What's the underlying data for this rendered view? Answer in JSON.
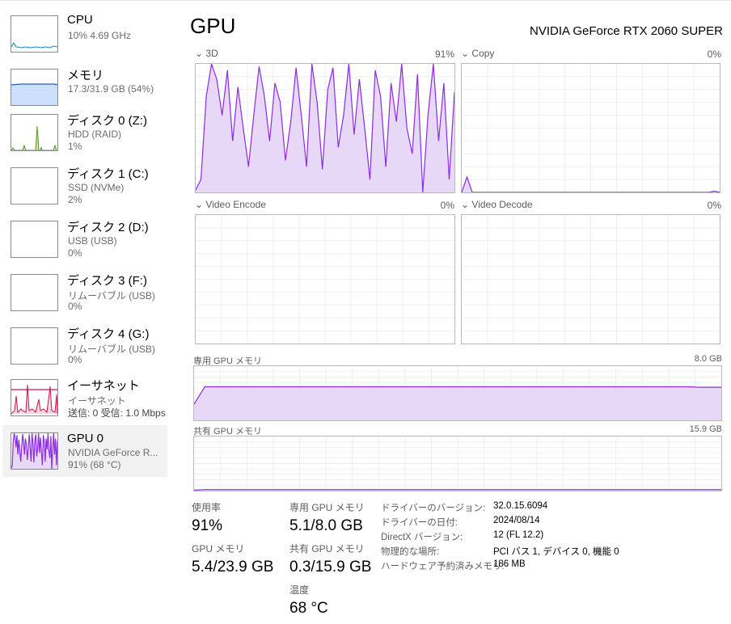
{
  "colors": {
    "gpu": "#8b2be2",
    "gpu_fill": "#e7d8f8",
    "cpu": "#1a8aa8",
    "mem": "#1f5fc9",
    "mem_fill": "#cce0fb",
    "disk": "#5e9c1e",
    "net": "#c5184c",
    "net_fill": "#f7d6df"
  },
  "sidebar": {
    "items": [
      {
        "title": "CPU",
        "line1": "10%  4.69 GHz",
        "line2": ""
      },
      {
        "title": "メモリ",
        "line1": "17.3/31.9 GB (54%)",
        "line2": ""
      },
      {
        "title": "ディスク 0 (Z:)",
        "line1": "HDD (RAID)",
        "line2": "1%"
      },
      {
        "title": "ディスク 1 (C:)",
        "line1": "SSD (NVMe)",
        "line2": "2%"
      },
      {
        "title": "ディスク 2 (D:)",
        "line1": "USB (USB)",
        "line2": "0%"
      },
      {
        "title": "ディスク 3 (F:)",
        "line1": "リムーバブル (USB)",
        "line2": "0%"
      },
      {
        "title": "ディスク 4 (G:)",
        "line1": "リムーバブル (USB)",
        "line2": "0%"
      },
      {
        "title": "イーサネット",
        "line1": "イーサネット",
        "line2": "送信: 0 受信: 1.0 Mbps"
      },
      {
        "title": "GPU 0",
        "line1": "NVIDIA GeForce R...",
        "line2": "91% (68 °C)"
      }
    ]
  },
  "header": {
    "title": "GPU",
    "model": "NVIDIA GeForce RTX 2060 SUPER"
  },
  "engines": [
    {
      "name": "3D",
      "value": "91%"
    },
    {
      "name": "Copy",
      "value": "0%"
    },
    {
      "name": "Video Encode",
      "value": "0%"
    },
    {
      "name": "Video Decode",
      "value": "0%"
    }
  ],
  "memory_graphs": {
    "dedicated": {
      "label": "専用 GPU メモリ",
      "max": "8.0 GB"
    },
    "shared": {
      "label": "共有 GPU メモリ",
      "max": "15.9 GB"
    }
  },
  "series": {
    "3d": [
      2,
      10,
      75,
      100,
      88,
      60,
      95,
      40,
      82,
      50,
      20,
      60,
      98,
      75,
      40,
      85,
      70,
      25,
      55,
      97,
      60,
      20,
      100,
      70,
      18,
      80,
      97,
      35,
      60,
      100,
      45,
      88,
      50,
      10,
      95,
      75,
      20,
      85,
      55,
      100,
      50,
      30,
      92,
      0,
      60,
      100,
      40,
      85,
      10,
      78
    ],
    "copy": [
      0,
      12,
      0,
      0,
      0,
      0,
      0,
      0,
      0,
      0,
      0,
      0,
      0,
      0,
      0,
      0,
      0,
      0,
      0,
      0,
      0,
      0,
      0,
      0,
      0,
      0,
      0,
      0,
      0,
      0,
      0,
      0,
      0,
      0,
      0,
      0,
      0,
      0,
      0,
      0,
      0,
      0,
      0,
      0,
      0,
      0,
      0,
      0,
      1,
      0
    ],
    "dedicated": [
      30,
      62,
      62,
      62,
      62,
      62,
      62,
      62,
      62,
      62,
      62,
      62,
      62,
      62,
      62,
      62,
      62,
      62,
      62,
      62,
      62,
      62,
      62,
      62,
      62,
      62,
      62,
      62,
      62,
      62,
      62,
      62,
      62,
      62,
      62,
      62,
      62,
      62,
      62,
      62,
      62,
      62,
      62,
      62,
      62,
      62,
      62,
      61,
      61,
      61
    ],
    "shared": [
      1,
      2,
      2,
      2,
      2,
      2,
      2,
      2,
      2,
      2,
      2,
      2,
      2,
      2,
      2,
      2,
      2,
      2,
      2,
      2,
      2,
      2,
      2,
      2,
      2,
      2,
      2,
      2,
      2,
      2,
      2,
      2,
      2,
      2,
      2,
      2,
      2,
      2,
      2,
      2,
      2,
      2,
      2,
      2,
      2,
      2,
      2,
      2,
      2,
      2
    ]
  },
  "stats": {
    "utilization": {
      "label": "使用率",
      "value": "91%"
    },
    "dedicated": {
      "label": "専用 GPU メモリ",
      "value": "5.1/8.0 GB"
    },
    "gpu_memory": {
      "label": "GPU メモリ",
      "value": "5.4/23.9 GB"
    },
    "shared": {
      "label": "共有 GPU メモリ",
      "value": "0.3/15.9 GB"
    },
    "temperature": {
      "label": "温度",
      "value": "68 °C"
    }
  },
  "info": [
    {
      "label": "ドライバーのバージョン:",
      "value": "32.0.15.6094"
    },
    {
      "label": "ドライバーの日付:",
      "value": "2024/08/14"
    },
    {
      "label": "DirectX バージョン:",
      "value": "12 (FL 12.2)"
    },
    {
      "label": "物理的な場所:",
      "value": "PCI バス 1, デバイス 0, 機能 0"
    },
    {
      "label": "ハードウェア予約済みメモリ:",
      "value": "186 MB"
    }
  ]
}
